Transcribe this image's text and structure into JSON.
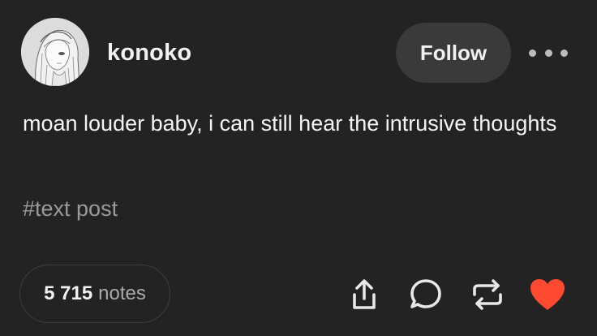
{
  "post": {
    "username": "konoko",
    "follow_label": "Follow",
    "text": "moan louder baby, i can still hear the intrusive thoughts",
    "tag": "#text post",
    "notes": {
      "count": "5 715",
      "label": "notes"
    }
  },
  "colors": {
    "background": "#232323",
    "follow_button": "#3a3a3a",
    "like_heart": "#ff4930",
    "muted_text": "#9a9a9a"
  },
  "icons": {
    "more": "more-options-icon",
    "share": "share-icon",
    "reply": "reply-icon",
    "reblog": "reblog-icon",
    "like": "heart-icon"
  }
}
